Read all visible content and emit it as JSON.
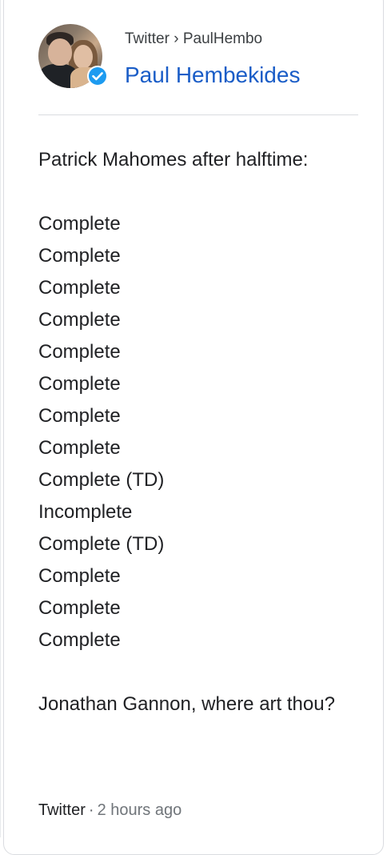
{
  "header": {
    "breadcrumb": "Twitter › PaulHembo",
    "author_name": "Paul Hembekides"
  },
  "tweet": {
    "intro": "Patrick Mahomes after halftime:",
    "plays": [
      "Complete",
      "Complete",
      "Complete",
      "Complete",
      "Complete",
      "Complete",
      "Complete",
      "Complete",
      "Complete (TD)",
      "Incomplete",
      "Complete (TD)",
      "Complete",
      "Complete",
      "Complete"
    ],
    "closing": "Jonathan Gannon, where art thou?"
  },
  "footer": {
    "source": "Twitter",
    "separator": "·",
    "time": "2 hours ago"
  },
  "colors": {
    "link": "#1a5dc7",
    "verified": "#1d9bf0",
    "text": "#202124",
    "muted": "#70757a"
  },
  "icons": {
    "verified": "verified-check-icon"
  }
}
